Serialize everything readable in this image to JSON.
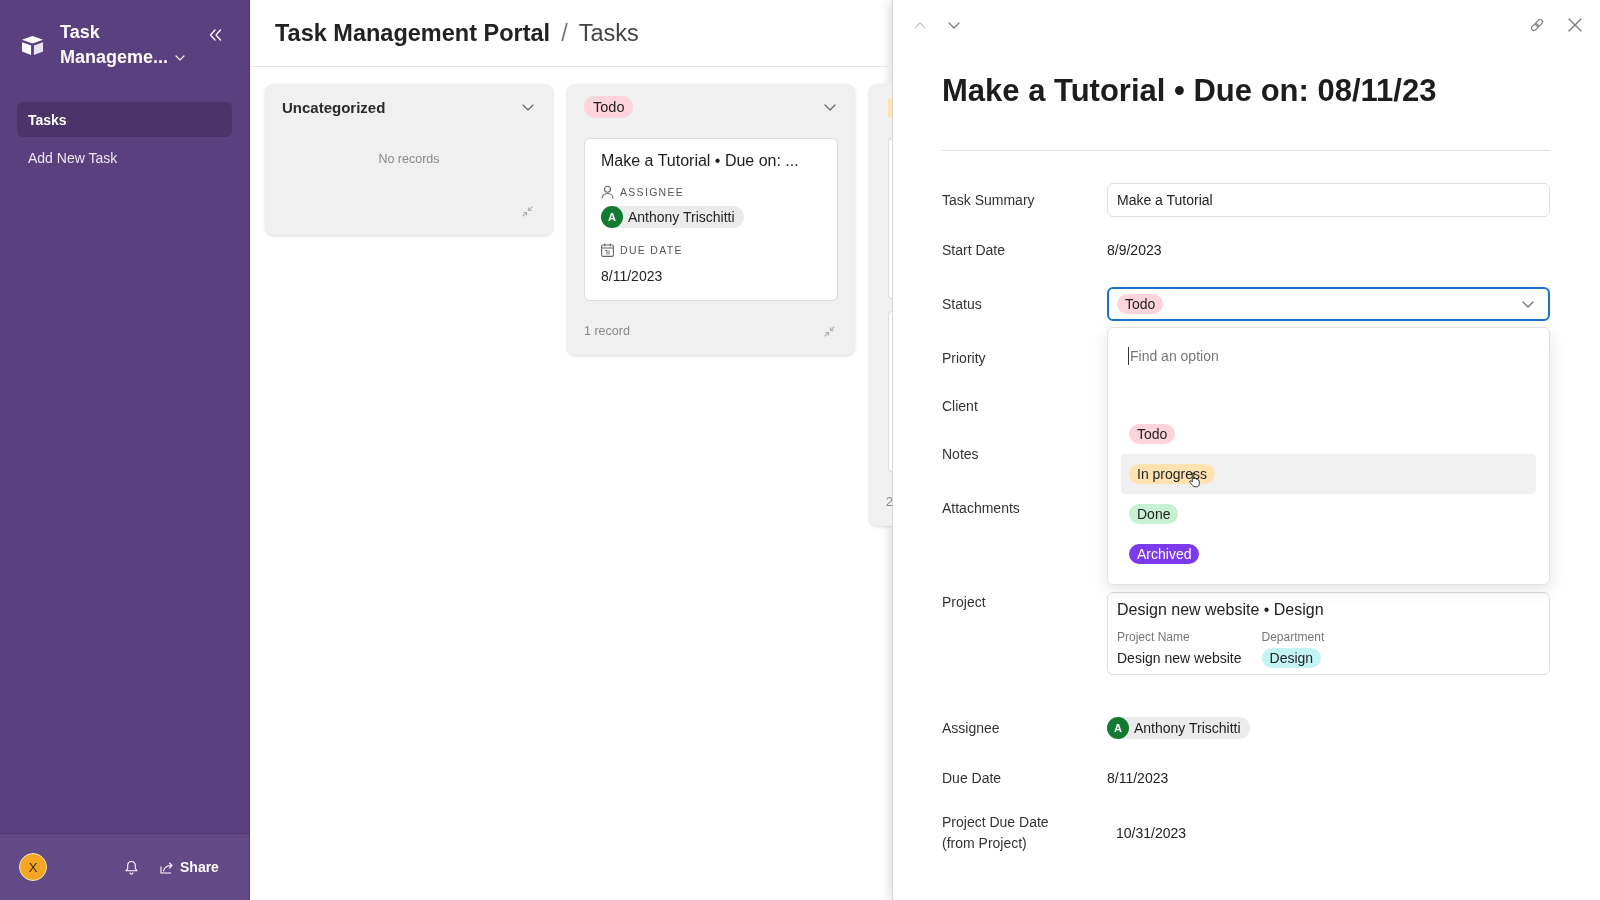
{
  "sidebar": {
    "workspace": "Task Manageme...",
    "nav": [
      {
        "label": "Tasks",
        "selected": true
      },
      {
        "label": "Add New Task",
        "selected": false
      }
    ],
    "user_initial": "X",
    "share_label": "Share"
  },
  "header": {
    "breadcrumb": [
      {
        "kind": "base",
        "label": "Task Management Portal"
      },
      {
        "kind": "separator",
        "label": "/"
      },
      {
        "kind": "current",
        "label": "Tasks"
      }
    ]
  },
  "board": {
    "columns": [
      {
        "kind": "plain",
        "title": "Uncategorized",
        "empty_text": "No records"
      },
      {
        "kind": "tag",
        "tag": {
          "label": "Todo",
          "color": "#fdd3dc"
        },
        "cards": [
          {
            "kind": "full",
            "title": "Make a Tutorial • Due on: ...",
            "fields": [
              {
                "kind": "person",
                "label": "ASSIGNEE",
                "initial": "A",
                "value": "Anthony Trischitti"
              },
              {
                "kind": "date",
                "label": "DUE DATE",
                "value": "8/11/2023"
              }
            ]
          }
        ],
        "footer": "1 record"
      },
      {
        "kind": "clipped",
        "tag": {
          "color": "#ffe2b0"
        },
        "cards": [
          {
            "kind": "clipped"
          },
          {
            "kind": "clipped"
          }
        ],
        "footer": "2"
      }
    ]
  },
  "record": {
    "title": "Make a Tutorial • Due on: 08/11/23",
    "fields": [
      {
        "kind": "input",
        "label": "Task Summary",
        "value": "Make a Tutorial"
      },
      {
        "kind": "text",
        "label": "Start Date",
        "value": "8/9/2023"
      },
      {
        "kind": "select",
        "label": "Status",
        "value": {
          "label": "Todo",
          "color": "#fdd3dc"
        },
        "expanded": true,
        "search": {
          "placeholder": "Find an option"
        },
        "options": [
          {
            "label": "Todo",
            "color": "#fdd3dc",
            "highlighted": false
          },
          {
            "label": "In progress",
            "color": "#ffe2b0",
            "highlighted": true
          },
          {
            "label": "Done",
            "color": "#c8f0d2",
            "highlighted": false
          },
          {
            "label": "Archived",
            "color": "#7c3aed",
            "highlighted": false
          }
        ]
      },
      {
        "kind": "covered",
        "label": "Priority"
      },
      {
        "kind": "covered",
        "label": "Client"
      },
      {
        "kind": "covered",
        "label": "Notes"
      },
      {
        "kind": "attachments",
        "label": "Attachments"
      },
      {
        "kind": "linked",
        "label": "Project",
        "value": {
          "title": "Design new website • Design",
          "fields": [
            {
              "kind": "text",
              "label": "Project Name",
              "value": "Design new website"
            },
            {
              "kind": "tag",
              "label": "Department",
              "value": "Design",
              "color": "#c4f3f3"
            }
          ]
        }
      },
      {
        "kind": "person",
        "label": "Assignee",
        "initial": "A",
        "value": "Anthony Trischitti"
      },
      {
        "kind": "text",
        "label": "Due Date",
        "value": "8/11/2023"
      },
      {
        "kind": "lookup",
        "label": "Project Due Date (from Project)",
        "value": "10/31/2023"
      }
    ]
  }
}
